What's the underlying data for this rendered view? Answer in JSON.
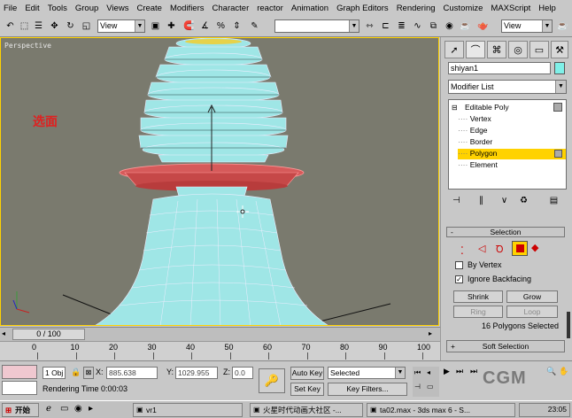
{
  "menu": [
    "File",
    "Edit",
    "Tools",
    "Group",
    "Views",
    "Create",
    "Modifiers",
    "Character",
    "reactor",
    "Animation",
    "Graph Editors",
    "Rendering",
    "Customize",
    "MAXScript",
    "Help"
  ],
  "toolbar": {
    "view_combo_left": "View",
    "view_combo_right": "View"
  },
  "viewport": {
    "label": "Perspective",
    "annotation": "选面",
    "highlight_color": "#ffd200"
  },
  "command_panel": {
    "object_name": "shiyan1",
    "object_color": "#7ff0e8",
    "modifier_list": "Modifier List",
    "stack": {
      "root": "Editable Poly",
      "items": [
        "Vertex",
        "Edge",
        "Border",
        "Polygon",
        "Element"
      ],
      "selected": "Polygon"
    },
    "selection": {
      "title": "Selection",
      "by_vertex": "By Vertex",
      "ignore_backfacing": "Ignore Backfacing",
      "shrink": "Shrink",
      "grow": "Grow",
      "ring": "Ring",
      "loop": "Loop",
      "status": "16 Polygons Selected"
    },
    "soft_selection": "Soft Selection"
  },
  "timeline": {
    "frame": "0 / 100",
    "ticks": [
      "0",
      "10",
      "20",
      "30",
      "40",
      "50",
      "60",
      "70",
      "80",
      "90",
      "100"
    ]
  },
  "status": {
    "objects": "1 Obj",
    "x_label": "X:",
    "x_value": "885.638",
    "y_label": "Y:",
    "y_value": "1029.955",
    "z_label": "Z:",
    "z_value": "0.0",
    "auto_key": "Auto Key",
    "set_key": "Set Key",
    "selected": "Selected",
    "key_filters": "Key Filters...",
    "render_time": "Rendering Time  0:00:03"
  },
  "taskbar": {
    "start": "开始",
    "tasks": [
      "vr1",
      "火星时代动画大社区 -...",
      "ta02.max - 3ds max 6 - S..."
    ],
    "clock": "23:05"
  },
  "watermark": "CGM"
}
